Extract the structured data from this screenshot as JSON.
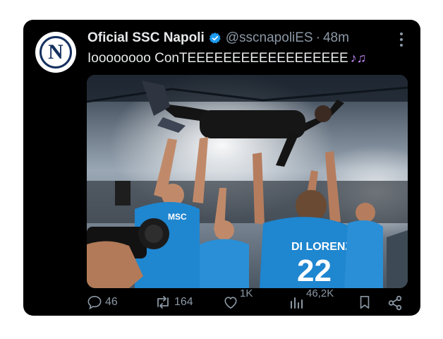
{
  "tweet": {
    "author_name": "Oficial SSC Napoli",
    "handle": "@sscnapoliES",
    "separator": "·",
    "time": "48m",
    "avatar_letter": "N",
    "text": "Ioooooooo ConTEEEEEEEEEEEEEEEEEE",
    "emoji": "♪♫"
  },
  "media": {
    "jersey_text": "DI LORENZO",
    "jersey_number": "22",
    "sponsor_text": "MSC"
  },
  "actions": {
    "replies": "46",
    "reposts": "164",
    "likes": "1K",
    "views": "46,2K"
  },
  "colors": {
    "background": "#000000",
    "text": "#e7e9ea",
    "muted": "#8b98a5",
    "verified": "#1d9bf0",
    "napoli_blue": "#14305f",
    "kit_blue": "#1f86d0"
  },
  "icons": [
    "verified-badge-icon",
    "more-icon",
    "reply-icon",
    "repost-icon",
    "like-icon",
    "views-icon",
    "bookmark-icon",
    "share-icon"
  ]
}
